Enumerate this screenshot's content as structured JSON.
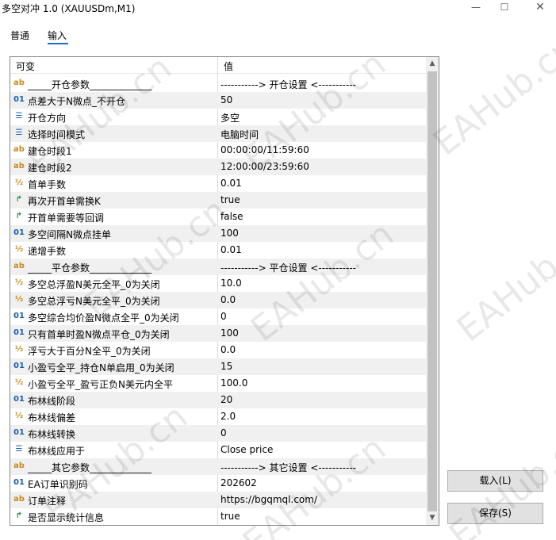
{
  "window": {
    "title": "多空对冲 1.0 (XAUUSDm,M1)",
    "min_glyph": "—",
    "max_glyph": "☐",
    "close_glyph": "✕"
  },
  "tabs": [
    {
      "label": "普通"
    },
    {
      "label": "输入",
      "active": true
    }
  ],
  "grid": {
    "header": {
      "name": "可变",
      "value": "值"
    },
    "rows": [
      {
        "icon": "ab",
        "name": "_____开仓参数_____________",
        "value": "-----------> 开仓设置 <-----------"
      },
      {
        "icon": "01",
        "name": "点差大于N微点_不开仓",
        "value": "50"
      },
      {
        "icon": "enum",
        "name": "开仓方向",
        "value": "多空"
      },
      {
        "icon": "enum",
        "name": "选择时间模式",
        "value": "电脑时间"
      },
      {
        "icon": "ab",
        "name": "建仓时段1",
        "value": "00:00:00/11:59:60"
      },
      {
        "icon": "ab",
        "name": "建仓时段2",
        "value": "12:00:00/23:59:60"
      },
      {
        "icon": "half",
        "name": "首单手数",
        "value": "0.01"
      },
      {
        "icon": "bool",
        "name": "再次开首单需换K",
        "value": "true"
      },
      {
        "icon": "bool",
        "name": "开首单需要等回调",
        "value": "false"
      },
      {
        "icon": "01",
        "name": "多空间隔N微点挂单",
        "value": "100"
      },
      {
        "icon": "half",
        "name": "递增手数",
        "value": "0.01"
      },
      {
        "icon": "ab",
        "name": "_____平仓参数_____________",
        "value": "-----------> 平仓设置 <-----------"
      },
      {
        "icon": "half",
        "name": "多空总浮盈N美元全平_0为关闭",
        "value": "10.0"
      },
      {
        "icon": "half",
        "name": "多空总浮亏N美元全平_0为关闭",
        "value": "0.0"
      },
      {
        "icon": "01",
        "name": "多空综合均价盈N微点全平_0为关闭",
        "value": "0"
      },
      {
        "icon": "01",
        "name": "只有首单时盈N微点平仓_0为关闭",
        "value": "100"
      },
      {
        "icon": "half",
        "name": "浮亏大于百分N全平_0为关闭",
        "value": "0.0"
      },
      {
        "icon": "01",
        "name": "小盈亏全平_持仓N单启用_0为关闭",
        "value": "15"
      },
      {
        "icon": "half",
        "name": "小盈亏全平_盈亏正负N美元内全平",
        "value": "100.0"
      },
      {
        "icon": "01",
        "name": "布林线阶段",
        "value": "20"
      },
      {
        "icon": "half",
        "name": "布林线偏差",
        "value": "2.0"
      },
      {
        "icon": "01",
        "name": "布林线转换",
        "value": "0"
      },
      {
        "icon": "enum",
        "name": "布林线应用于",
        "value": "Close price"
      },
      {
        "icon": "ab",
        "name": "_____其它参数_____________",
        "value": "-----------> 其它设置 <-----------"
      },
      {
        "icon": "01",
        "name": "EA订单识别码",
        "value": "202602"
      },
      {
        "icon": "ab",
        "name": "订单注释",
        "value": "https://bgqmql.com/"
      },
      {
        "icon": "bool",
        "name": "是否显示统计信息",
        "value": "true"
      }
    ]
  },
  "buttons": {
    "load": "载入(L)",
    "save": "保存(S)"
  },
  "icon_glyphs": {
    "ab": "ab",
    "01": "01",
    "half": "½",
    "enum": "☰",
    "bool": "↱"
  },
  "scrollbar": {
    "up": "▲",
    "down": "▼"
  },
  "watermark": "EAHub.cn"
}
